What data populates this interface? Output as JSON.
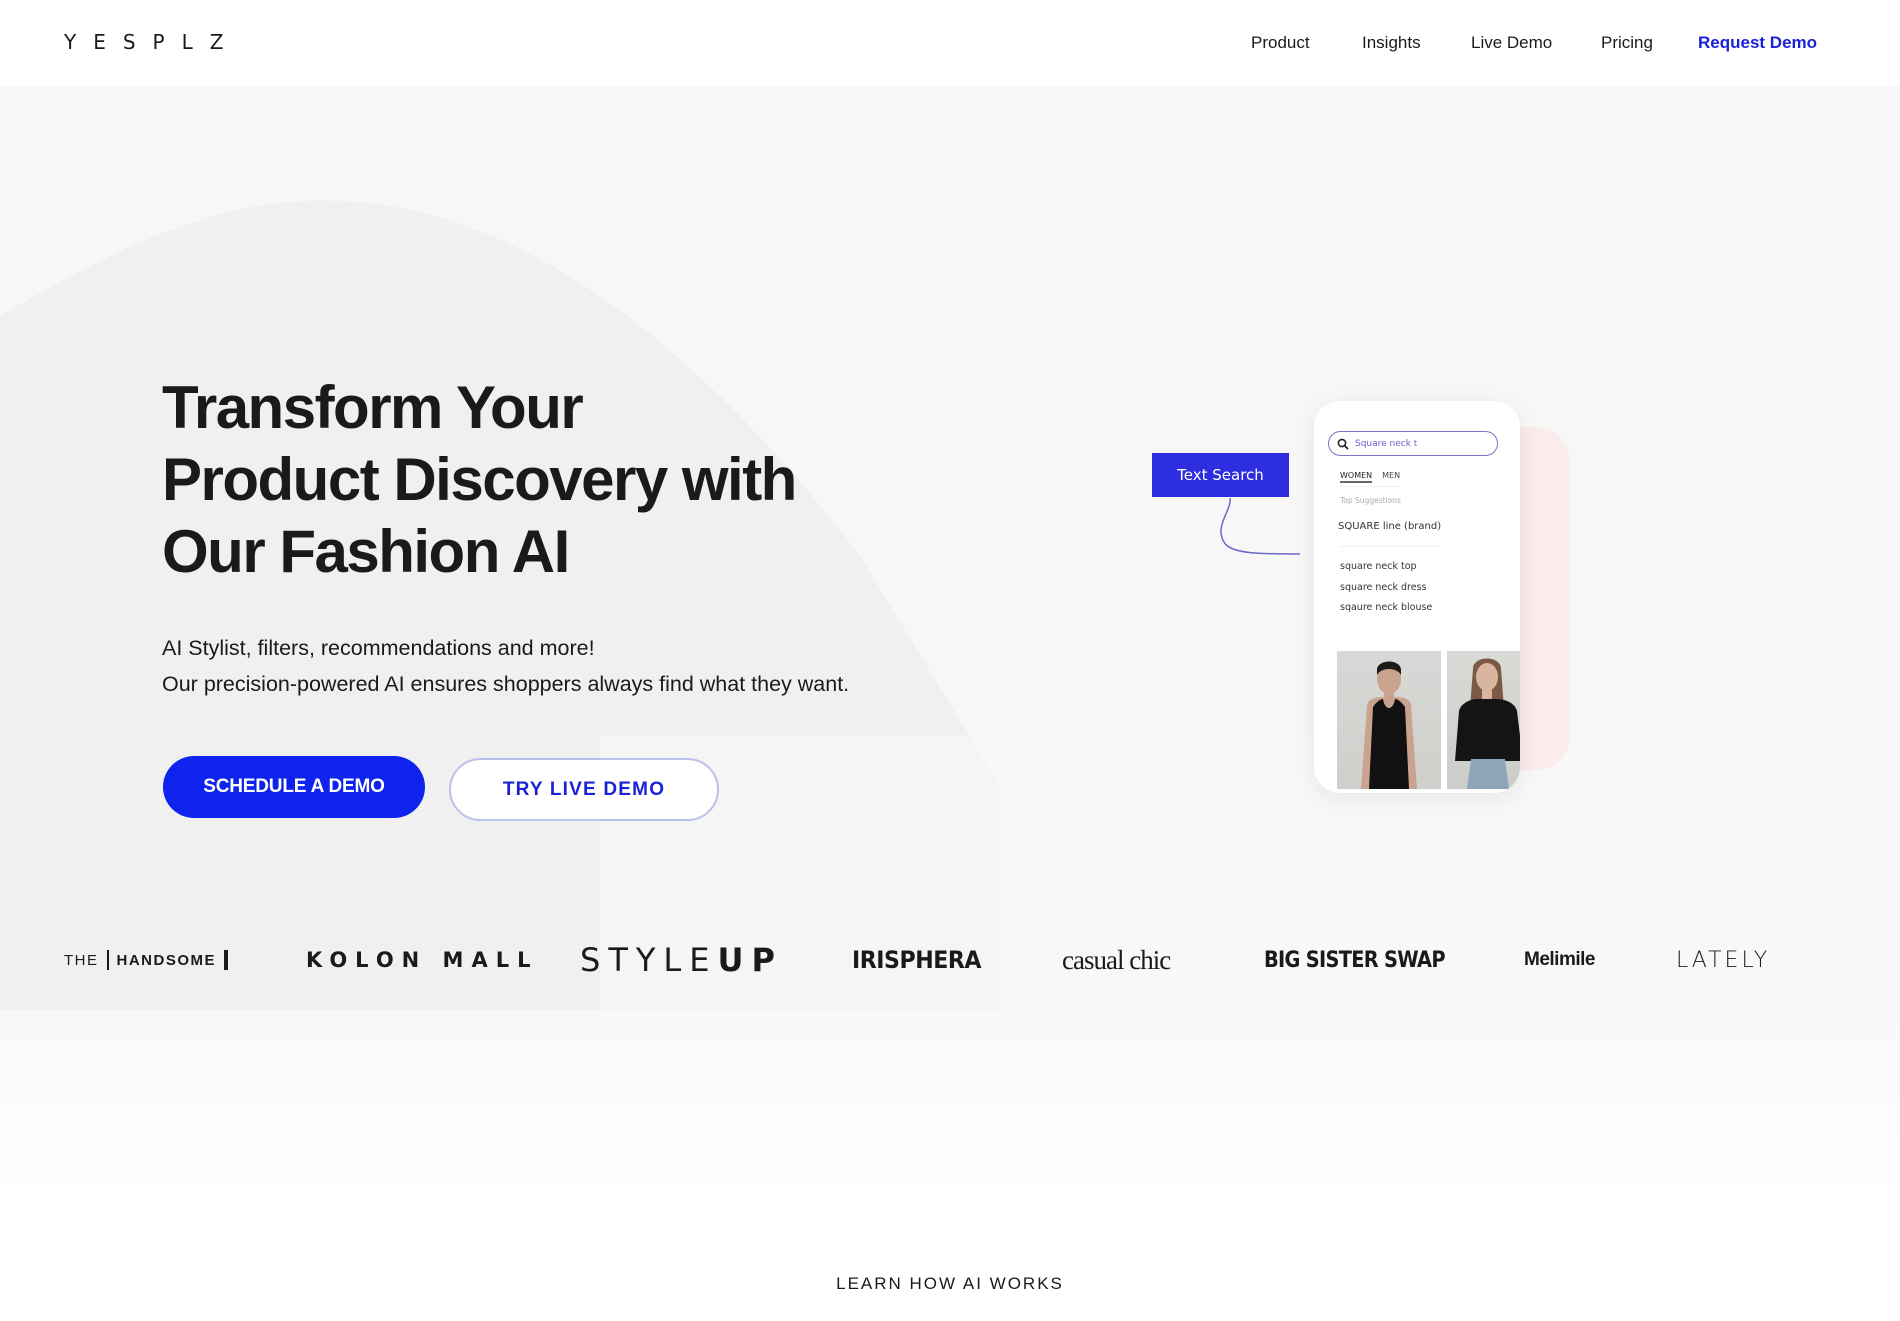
{
  "header": {
    "logo": "YESPLZ",
    "nav": [
      {
        "label": "Product"
      },
      {
        "label": "Insights"
      },
      {
        "label": "Live Demo"
      },
      {
        "label": "Pricing"
      }
    ],
    "cta_label": "Request Demo",
    "accent_color": "#1a22d6"
  },
  "hero": {
    "headline_lines": [
      "Transform Your",
      "Product Discovery with",
      "Our Fashion AI"
    ],
    "subtitle_lines": [
      "AI Stylist, filters, recommendations and more!",
      "Our precision-powered AI ensures shoppers always find what they want."
    ],
    "primary_button": "SCHEDULE A DEMO",
    "secondary_button": "TRY LIVE DEMO",
    "primary_color": "#0f23ee"
  },
  "mockup": {
    "tag_label": "Text Search",
    "search_icon": "search-icon",
    "search_query": "Square neck t",
    "gender_tabs": [
      {
        "label": "WOMEN",
        "active": true
      },
      {
        "label": "MEN",
        "active": false
      }
    ],
    "top_suggestions_label": "Top Suggestions",
    "brand_suggestion": "SQUARE line (brand)",
    "suggestions": [
      "square neck top",
      "square neck dress",
      "sqaure neck blouse"
    ],
    "photos": [
      {
        "alt": "model-in-black-tank-top"
      },
      {
        "alt": "model-in-black-square-neck-top"
      }
    ]
  },
  "logos": {
    "handsome": {
      "the": "THE",
      "name": "HANDSOME"
    },
    "kolon": "KOLON MALL",
    "styleup": {
      "light": "STYLE",
      "bold": "UP"
    },
    "irisphera": "IRISPHERA",
    "casual_chic": "casual chic",
    "big_sister_swap": "BIG SISTER SWAP",
    "melimile": "Melimile",
    "lately": "LATELY"
  },
  "footer_section": {
    "learn_label": "LEARN HOW AI WORKS"
  }
}
